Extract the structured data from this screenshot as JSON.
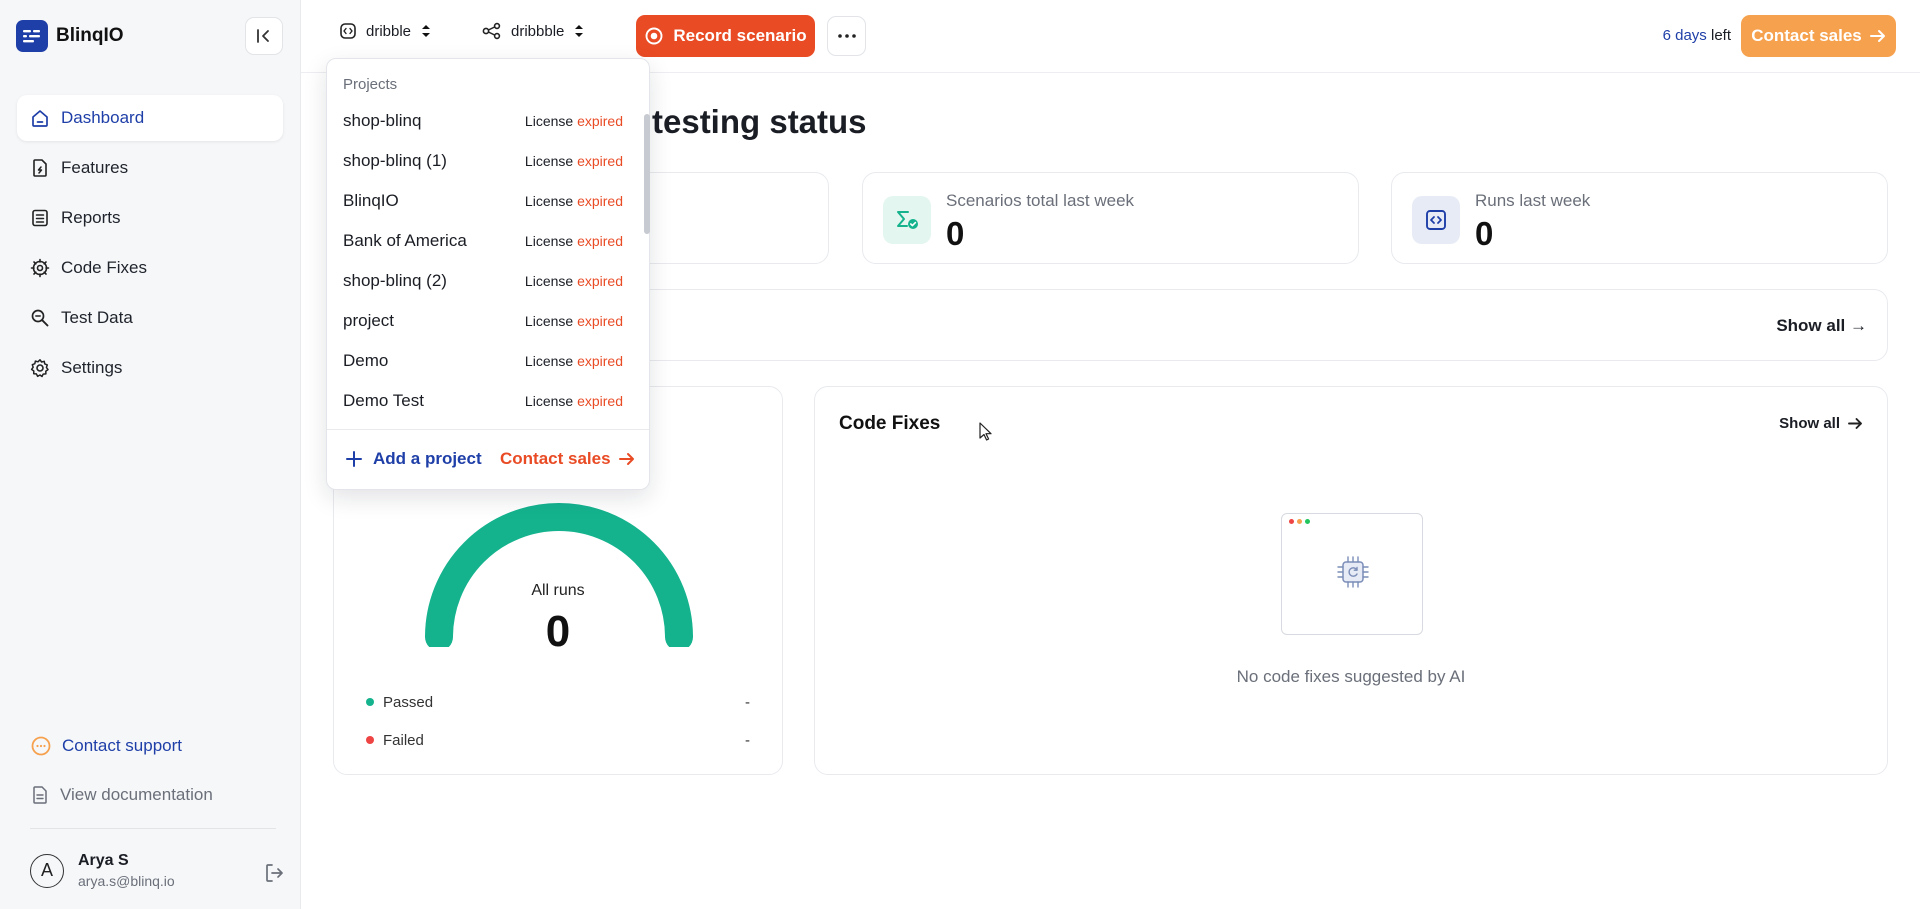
{
  "app": {
    "name": "BlinqIO"
  },
  "sidebar": {
    "nav": [
      {
        "label": "Dashboard",
        "active": true
      },
      {
        "label": "Features"
      },
      {
        "label": "Reports"
      },
      {
        "label": "Code Fixes"
      },
      {
        "label": "Test Data"
      },
      {
        "label": "Settings"
      }
    ],
    "contact_support": "Contact support",
    "view_documentation": "View documentation",
    "user": {
      "initial": "A",
      "name": "Arya S",
      "email": "arya.s@blinq.io"
    }
  },
  "topbar": {
    "project_selector": "dribble",
    "branch_selector": "dribbble",
    "record_label": "Record scenario",
    "trial_days": "6 days",
    "trial_suffix": " left",
    "contact_sales": "Contact sales"
  },
  "page": {
    "title_fragment": "testing status"
  },
  "stats": [
    {
      "label": "Scenarios total last week",
      "value": "0",
      "icon": "scenario-check-icon"
    },
    {
      "label": "Runs last week",
      "value": "0",
      "icon": "code-runs-icon"
    }
  ],
  "recent": {
    "show_all": "Show all →"
  },
  "runs_chart": {
    "label": "All runs",
    "total": "0",
    "legend": [
      {
        "label": "Passed",
        "value": "-",
        "color": "#14b38e"
      },
      {
        "label": "Failed",
        "value": "-",
        "color": "#ef4444"
      }
    ]
  },
  "code_fixes": {
    "title": "Code Fixes",
    "show_all": "Show all",
    "empty_text": "No code fixes suggested by AI"
  },
  "projects_dropdown": {
    "heading": "Projects",
    "license_word": "License ",
    "expired_word": "expired",
    "items": [
      {
        "name": "shop-blinq"
      },
      {
        "name": "shop-blinq (1)"
      },
      {
        "name": "BlinqIO"
      },
      {
        "name": "Bank of America"
      },
      {
        "name": "shop-blinq (2)"
      },
      {
        "name": "project"
      },
      {
        "name": "Demo"
      },
      {
        "name": "Demo Test"
      }
    ],
    "add_project": "Add a project",
    "contact_sales": "Contact sales"
  },
  "colors": {
    "brand": "#1f3fa8",
    "accent": "#e94b25",
    "cta": "#f6a14e",
    "success": "#14b38e"
  }
}
